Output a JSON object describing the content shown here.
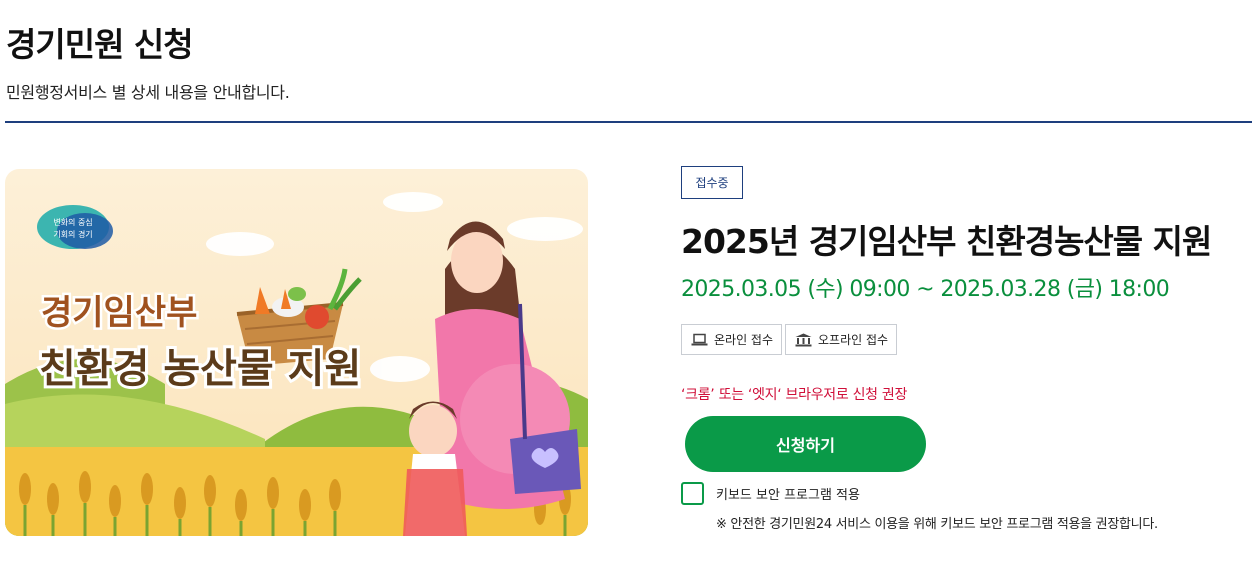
{
  "page": {
    "title": "경기민원 신청",
    "subtitle": "민원행정서비스 별 상세 내용을 안내합니다."
  },
  "banner": {
    "logo_line1": "변화의 중심",
    "logo_line2": "기회의 경기",
    "headline1": "경기임산부",
    "headline2": "친환경 농산물 지원"
  },
  "service": {
    "status": "접수중",
    "title": "2025년 경기임산부 친환경농산물 지원",
    "period": "2025.03.05 (수) 09:00 ~ 2025.03.28 (금) 18:00",
    "methods": [
      {
        "label": "온라인 접수",
        "icon": "laptop-icon"
      },
      {
        "label": "오프라인 접수",
        "icon": "building-icon"
      }
    ],
    "browser_notice": "‘크롬’ 또는 ‘엣지‘ 브라우저로 신청 권장",
    "apply_label": "신청하기",
    "keyboard_label": "키보드 보안 프로그램 적용",
    "keyboard_note": "※ 안전한 경기민원24 서비스 이용을 위해 키보드 보안 프로그램 적용을 권장합니다."
  },
  "colors": {
    "accent_green": "#0a9a48",
    "period_green": "#0a8f3d",
    "navy": "#1e3f7e",
    "notice_red": "#d0103a"
  }
}
